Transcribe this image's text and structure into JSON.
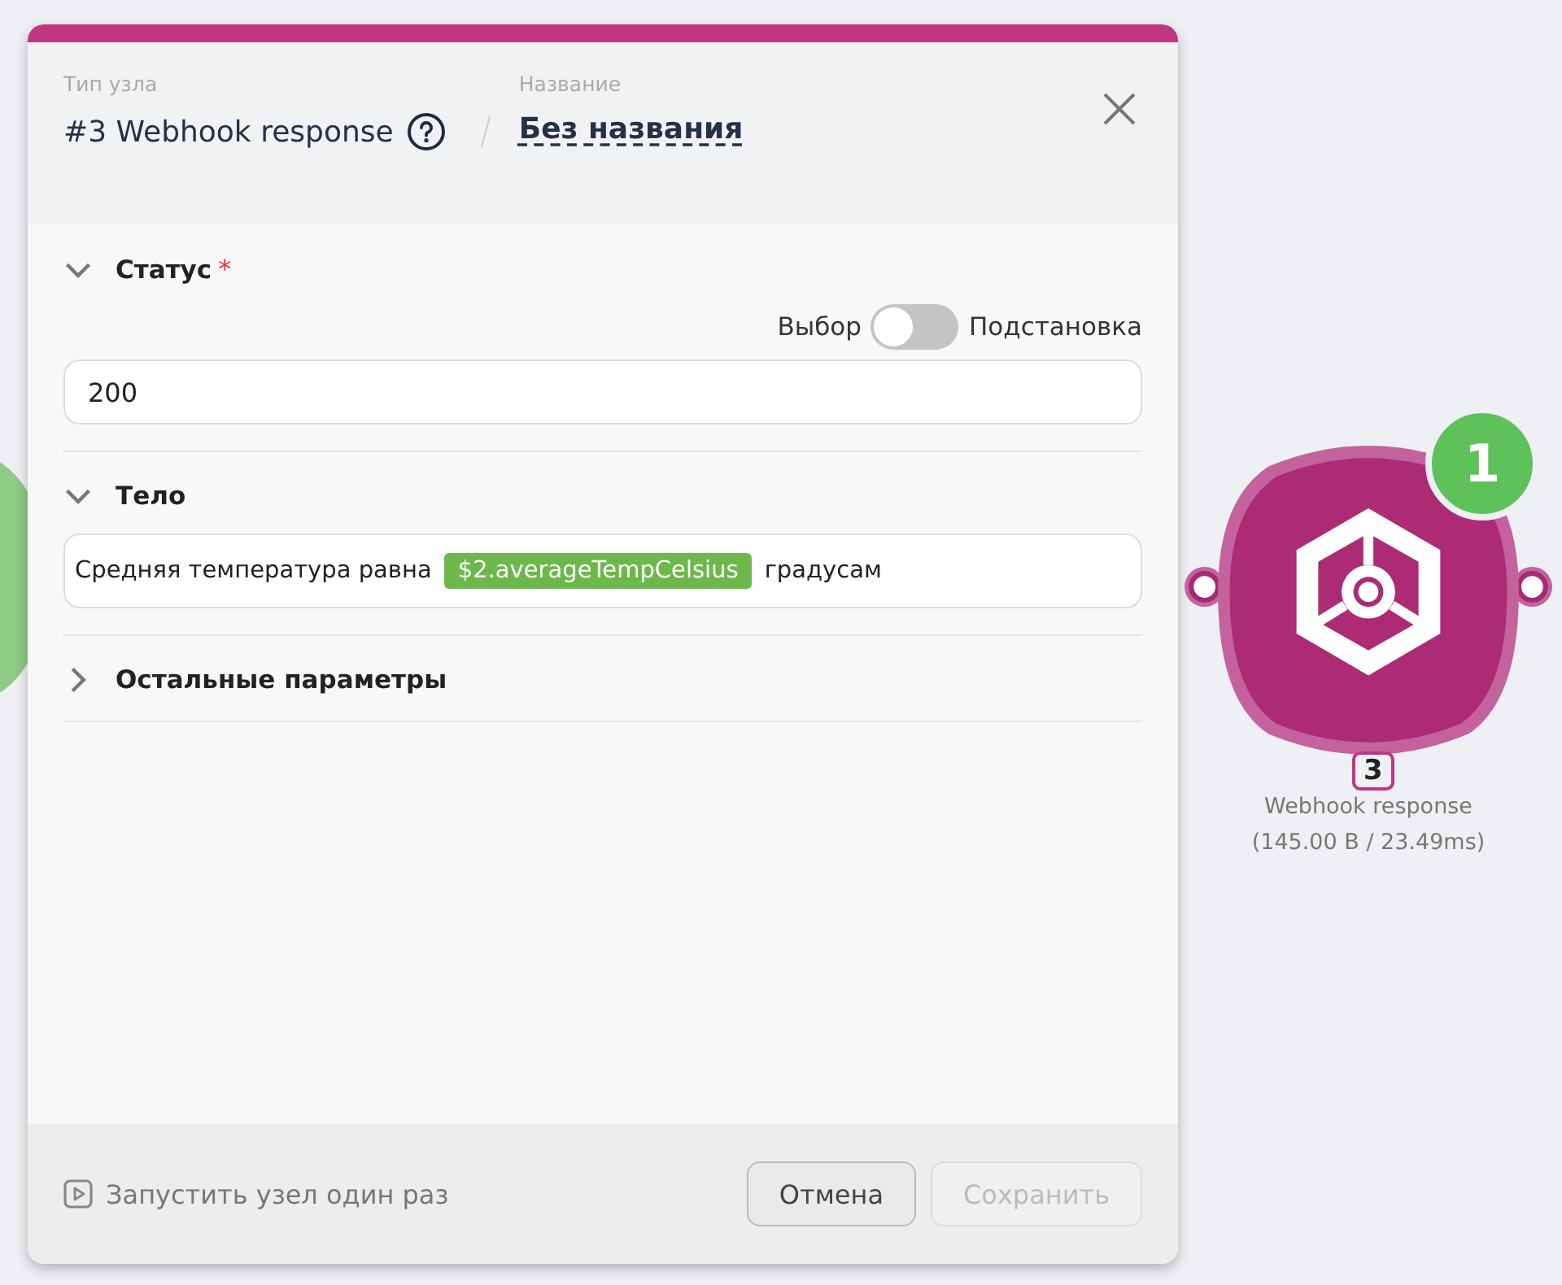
{
  "dialog": {
    "type_label": "Тип узла",
    "type_value": "#3 Webhook response",
    "name_label": "Название",
    "name_value": "Без названия"
  },
  "sections": [
    {
      "kind": "status",
      "title": "Статус",
      "required_mark": "*",
      "expanded": true,
      "toggle": {
        "left_label": "Выбор",
        "right_label": "Подстановка",
        "on": false
      },
      "value": "200"
    },
    {
      "kind": "body",
      "title": "Тело",
      "expanded": true,
      "segments": [
        {
          "kind": "text",
          "text": "Средняя температура равна"
        },
        {
          "kind": "token",
          "text": "$2.averageTempCelsius"
        },
        {
          "kind": "text",
          "text": "градусам"
        }
      ]
    },
    {
      "kind": "other",
      "title": "Остальные параметры",
      "expanded": false
    }
  ],
  "footer": {
    "run_once": "Запустить узел один раз",
    "buttons": [
      {
        "label": "Отмена",
        "disabled": false
      },
      {
        "label": "Сохранить",
        "disabled": true
      }
    ]
  },
  "node": {
    "badge": "1",
    "number": "3",
    "name": "Webhook response",
    "stats": "(145.00 B / 23.49ms)"
  }
}
